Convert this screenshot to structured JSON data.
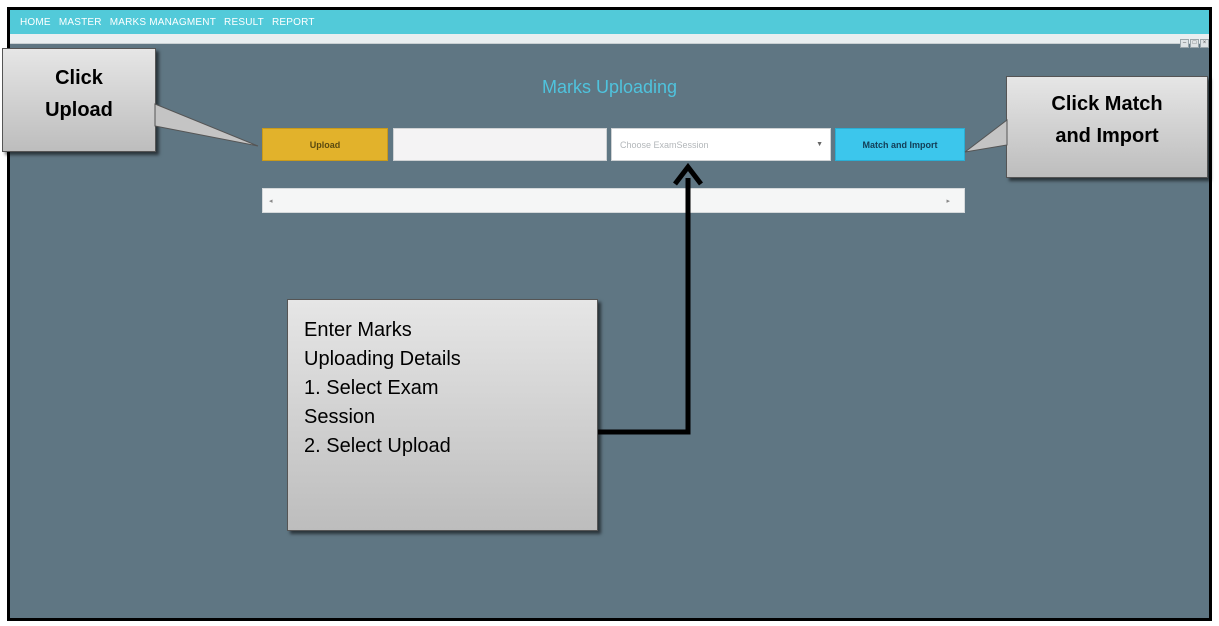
{
  "menu": [
    "HOME",
    "MASTER",
    "MARKS MANAGMENT",
    "RESULT",
    "REPORT"
  ],
  "title": "Marks Uploading",
  "form": {
    "upload_label": "Upload",
    "file_value": "",
    "session_placeholder": "Choose ExamSession",
    "match_label": "Match and Import"
  },
  "callouts": {
    "upload": [
      "Click",
      "Upload"
    ],
    "match": [
      "Click Match",
      "and Import"
    ],
    "details": [
      "Enter Marks",
      "Uploading Details",
      "1. Select Exam",
      "Session",
      "2. Select Upload"
    ]
  },
  "colors": {
    "menubar": "#52cad9",
    "background": "#5f7683",
    "upload_button": "#e2b22b",
    "match_button": "#3cc6ec",
    "title": "#4fc3dd"
  }
}
